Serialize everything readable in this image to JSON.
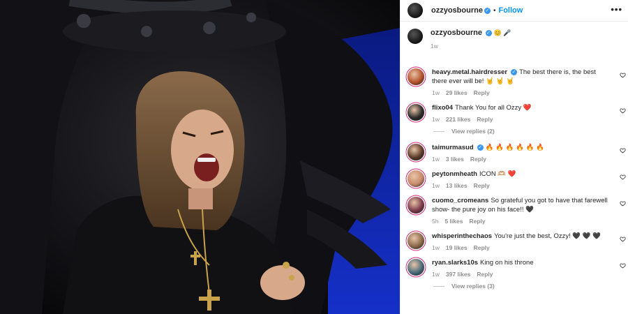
{
  "post": {
    "author": "ozzyosbourne",
    "follow_label": "Follow",
    "dot": "•",
    "more_label": "•••"
  },
  "caption": {
    "author": "ozzyosbourne",
    "text": "😊 🎤",
    "time": "1w"
  },
  "comments": [
    {
      "user": "heavy.metal.hairdresser",
      "verified": true,
      "text": "The best there is, the best there ever will be! 🤘 🤘 🤘",
      "time": "1w",
      "likes": "29 likes",
      "reply": "Reply",
      "avatar_color": "#b5532c"
    },
    {
      "user": "flixo04",
      "verified": false,
      "text": "Thank You for all Ozzy ❤️",
      "time": "1w",
      "likes": "221 likes",
      "reply": "Reply",
      "view_replies": "View replies (2)",
      "avatar_color": "#2a2a2a"
    },
    {
      "user": "taimurmasud",
      "verified": true,
      "text": "🔥 🔥 🔥 🔥 🔥 🔥",
      "time": "1w",
      "likes": "3 likes",
      "reply": "Reply",
      "avatar_color": "#5a3a2a"
    },
    {
      "user": "peytonmheath",
      "verified": false,
      "text": "ICON 🫶🏼 ❤️",
      "time": "1w",
      "likes": "13 likes",
      "reply": "Reply",
      "avatar_color": "#c98a6a"
    },
    {
      "user": "cuomo_cromeans",
      "verified": false,
      "text": "So grateful you got to have that farewell show- the pure joy on his face!! 🖤",
      "time": "5h",
      "likes": "5 likes",
      "reply": "Reply",
      "avatar_color": "#7a3a4a"
    },
    {
      "user": "whisperinthechaos",
      "verified": false,
      "text": "You're just the best, Ozzy! 🖤 🖤 🖤",
      "time": "1w",
      "likes": "19 likes",
      "reply": "Reply",
      "avatar_color": "#8a6a4a"
    },
    {
      "user": "ryan.slarks10s",
      "verified": false,
      "text": "King on his throne",
      "time": "1w",
      "likes": "397 likes",
      "reply": "Reply",
      "view_replies": "View replies (3)",
      "avatar_color": "#4a6a7a"
    }
  ],
  "colors": {
    "accent": "#0095f6",
    "verified": "#3897f0",
    "muted": "#8e8e8e",
    "heart_icon": "heart-outline-icon",
    "verified_icon": "verified-badge-icon"
  }
}
